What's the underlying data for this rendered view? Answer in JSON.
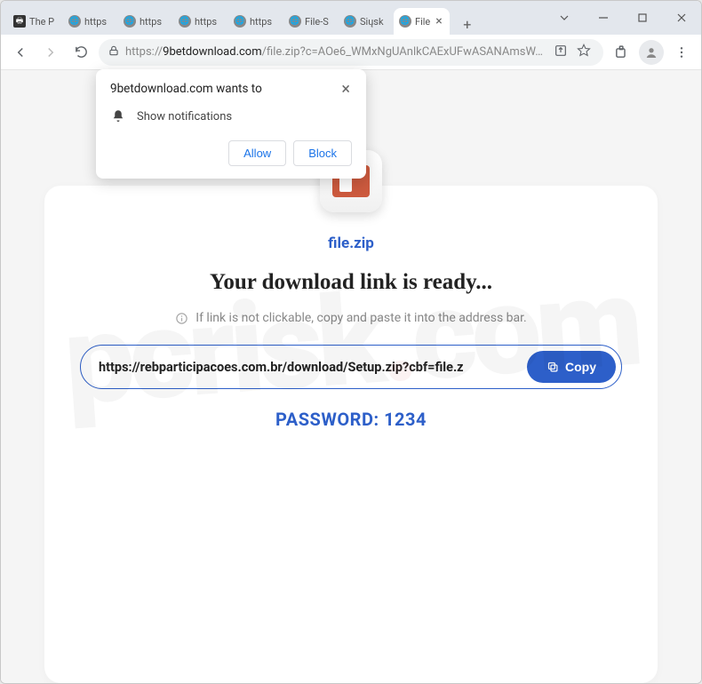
{
  "tabs": [
    {
      "label": "The P",
      "favtype": "printer"
    },
    {
      "label": "https",
      "favtype": "globe"
    },
    {
      "label": "https",
      "favtype": "globe"
    },
    {
      "label": "https",
      "favtype": "globe"
    },
    {
      "label": "https",
      "favtype": "globe"
    },
    {
      "label": "File-S",
      "favtype": "globe"
    },
    {
      "label": "Siųsk",
      "favtype": "globe"
    },
    {
      "label": "File",
      "favtype": "globe",
      "active": true
    }
  ],
  "address": {
    "scheme": "https://",
    "host": "9betdownload.com",
    "path": "/file.zip?c=AOe6_WMxNgUAnlkCAExUFwASANAmsW…"
  },
  "notification": {
    "title": "9betdownload.com wants to",
    "text": "Show notifications",
    "allow": "Allow",
    "block": "Block"
  },
  "page": {
    "filename": "file.zip",
    "headline": "Your download link is ready...",
    "hint": "If link is not clickable, copy and paste it into the address bar.",
    "download_url": "https://rebparticipacoes.com.br/download/Setup.zip?cbf=file.z",
    "copy_label": "Copy",
    "password_label": "PASSWORD: 1234"
  },
  "watermark": {
    "left": "pcrisk",
    "dot": ".",
    "right": "com"
  }
}
